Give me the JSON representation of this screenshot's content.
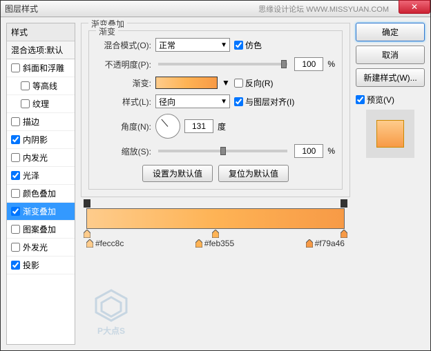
{
  "window": {
    "title": "图层样式",
    "watermark": "思缘设计论坛 WWW.MISSYUAN.COM"
  },
  "styles": {
    "header": "样式",
    "sub": "混合选项:默认",
    "items": [
      {
        "label": "斜面和浮雕",
        "checked": false,
        "indent": false
      },
      {
        "label": "等高线",
        "checked": false,
        "indent": true
      },
      {
        "label": "纹理",
        "checked": false,
        "indent": true
      },
      {
        "label": "描边",
        "checked": false,
        "indent": false
      },
      {
        "label": "内阴影",
        "checked": true,
        "indent": false
      },
      {
        "label": "内发光",
        "checked": false,
        "indent": false
      },
      {
        "label": "光泽",
        "checked": true,
        "indent": false
      },
      {
        "label": "颜色叠加",
        "checked": false,
        "indent": false
      },
      {
        "label": "渐变叠加",
        "checked": true,
        "indent": false,
        "active": true
      },
      {
        "label": "图案叠加",
        "checked": false,
        "indent": false
      },
      {
        "label": "外发光",
        "checked": false,
        "indent": false
      },
      {
        "label": "投影",
        "checked": true,
        "indent": false
      }
    ]
  },
  "gradient": {
    "group_title": "渐变叠加",
    "sub_title": "渐变",
    "blend_label": "混合模式(O):",
    "blend_value": "正常",
    "dither": "仿色",
    "opacity_label": "不透明度(P):",
    "opacity_value": "100",
    "pct": "%",
    "grad_label": "渐变:",
    "reverse": "反向(R)",
    "style_label": "样式(L):",
    "style_value": "径向",
    "align": "与图层对齐(I)",
    "angle_label": "角度(N):",
    "angle_value": "131",
    "deg": "度",
    "scale_label": "缩放(S):",
    "scale_value": "100",
    "btn_default": "设置为默认值",
    "btn_reset": "复位为默认值"
  },
  "stops": {
    "c1": "#fecc8c",
    "c2": "#feb355",
    "c3": "#f79a46"
  },
  "actions": {
    "ok": "确定",
    "cancel": "取消",
    "new_style": "新建样式(W)...",
    "preview": "预览(V)"
  },
  "logo": "P大点S"
}
